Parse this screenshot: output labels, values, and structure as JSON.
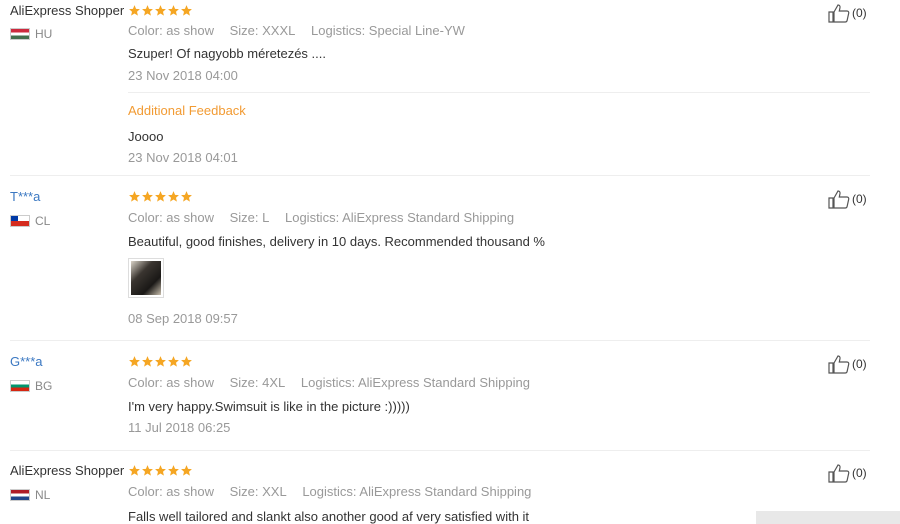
{
  "reviews": [
    {
      "name": "AliExpress Shopper",
      "country": "HU",
      "color": "Color: as show",
      "size": "Size: XXXL",
      "logistics": "Logistics: Special Line-YW",
      "text": "Szuper! Of nagyobb méretezés ....",
      "date": "23 Nov 2018 04:00",
      "additional_label": "Additional Feedback",
      "additional_text": "Joooo",
      "additional_date": "23 Nov 2018 04:01",
      "likes": "(0)",
      "rating": 5
    },
    {
      "name": "T***a",
      "country": "CL",
      "color": "Color: as show",
      "size": "Size: L",
      "logistics": "Logistics: AliExpress Standard Shipping",
      "text": "Beautiful, good finishes, delivery in 10 days. Recommended thousand %",
      "date": "08 Sep 2018 09:57",
      "likes": "(0)",
      "rating": 5
    },
    {
      "name": "G***a",
      "country": "BG",
      "color": "Color: as show",
      "size": "Size: 4XL",
      "logistics": "Logistics: AliExpress Standard Shipping",
      "text": "I'm very happy.Swimsuit is like in the picture :)))))",
      "date": "11 Jul 2018 06:25",
      "likes": "(0)",
      "rating": 5
    },
    {
      "name": "AliExpress Shopper",
      "country": "NL",
      "color": "Color: as show",
      "size": "Size: XXL",
      "logistics": "Logistics: AliExpress Standard Shipping",
      "text": "Falls well tailored and slankt also another good af very satisfied with it",
      "likes": "(0)",
      "rating": 5
    }
  ],
  "colors": {
    "star": "#f5a623",
    "masked_name": "#3b78c2",
    "additional": "#f29b33"
  },
  "icons": {
    "like": "thumbs-up-icon",
    "star": "star-icon"
  }
}
